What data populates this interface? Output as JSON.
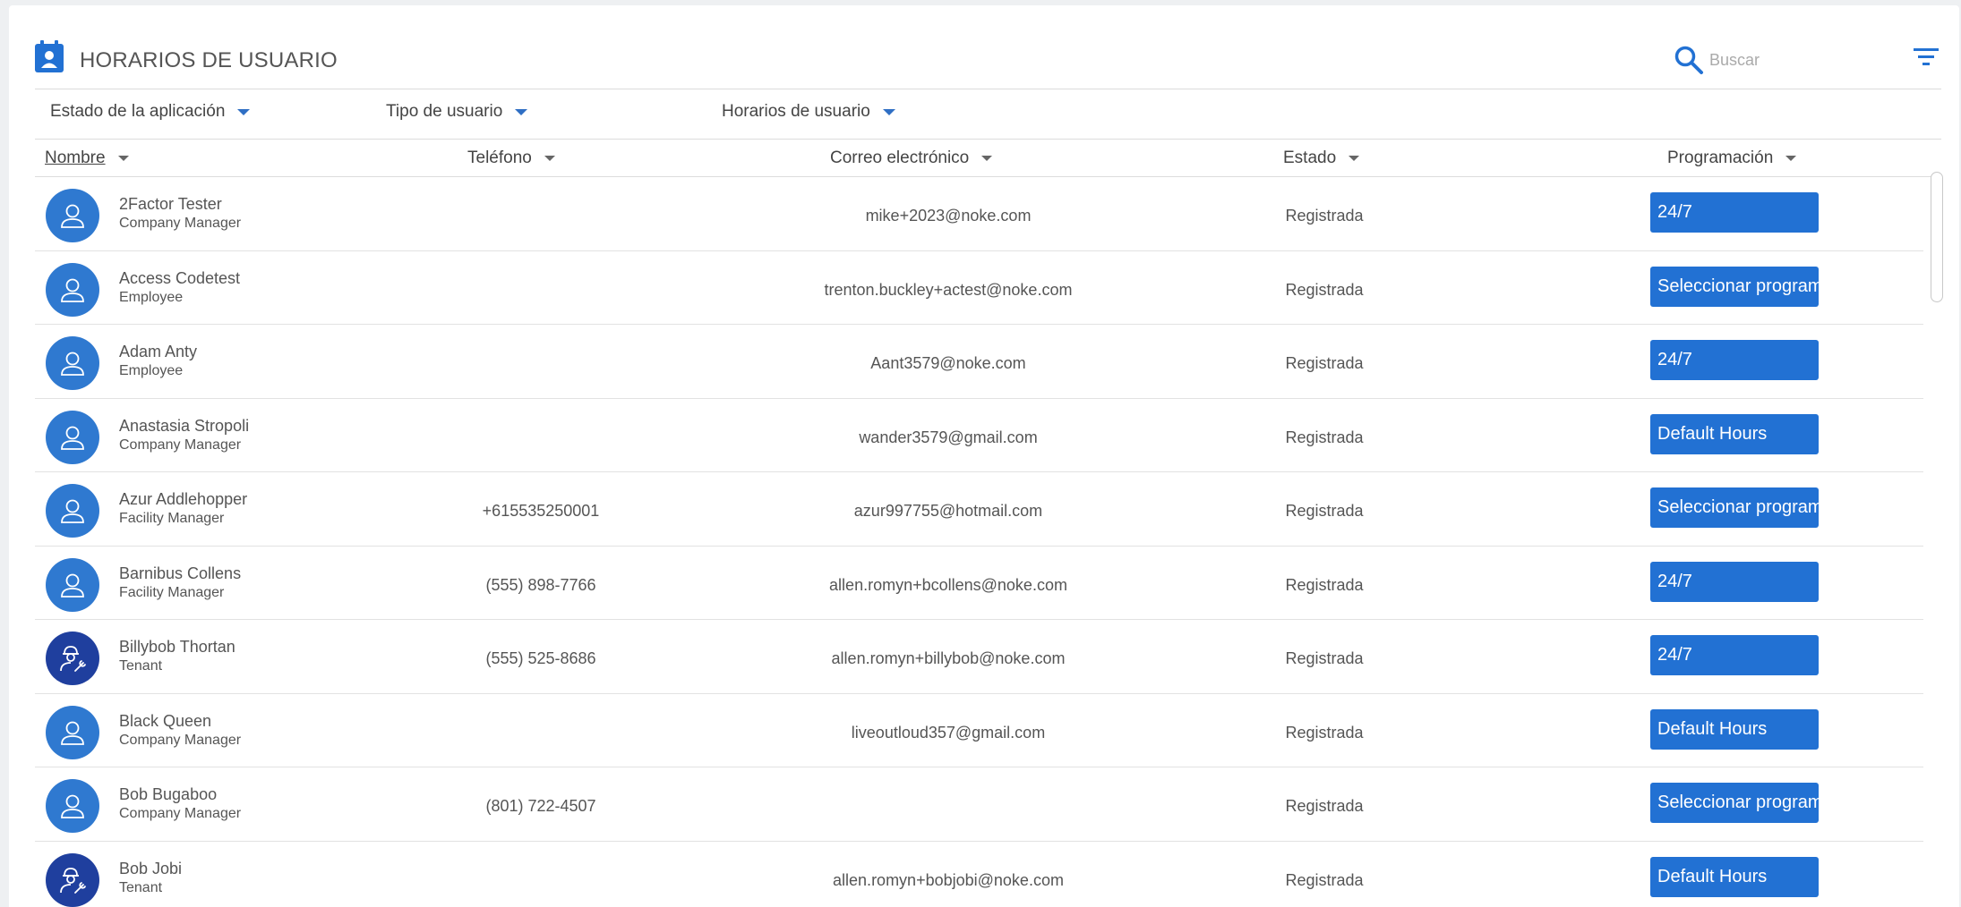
{
  "header": {
    "title": "HORARIOS DE USUARIO",
    "search_placeholder": "Buscar",
    "accent": "#2271d3"
  },
  "filters": [
    {
      "label": "Estado de la aplicación"
    },
    {
      "label": "Tipo de usuario"
    },
    {
      "label": "Horarios de usuario"
    }
  ],
  "columns": {
    "name": "Nombre",
    "phone": "Teléfono",
    "email": "Correo electrónico",
    "status": "Estado",
    "schedule": "Programación"
  },
  "rows": [
    {
      "name": "2Factor Tester",
      "role": "Company Manager",
      "phone": "",
      "email": "mike+2023@noke.com",
      "status": "Registrada",
      "schedule": "24/7",
      "avatar": "person-icon"
    },
    {
      "name": "Access Codetest",
      "role": "Employee",
      "phone": "",
      "email": "trenton.buckley+actest@noke.com",
      "status": "Registrada",
      "schedule": "Seleccionar programa",
      "avatar": "person-icon"
    },
    {
      "name": "Adam Anty",
      "role": "Employee",
      "phone": "",
      "email": "Aant3579@noke.com",
      "status": "Registrada",
      "schedule": "24/7",
      "avatar": "person-icon"
    },
    {
      "name": "Anastasia Stropoli",
      "role": "Company Manager",
      "phone": "",
      "email": "wander3579@gmail.com",
      "status": "Registrada",
      "schedule": "Default Hours",
      "avatar": "person-icon"
    },
    {
      "name": "Azur Addlehopper",
      "role": "Facility Manager",
      "phone": "+615535250001",
      "email": "azur997755@hotmail.com",
      "status": "Registrada",
      "schedule": "Seleccionar programa",
      "avatar": "person-icon"
    },
    {
      "name": "Barnibus Collens",
      "role": "Facility Manager",
      "phone": "(555) 898-7766",
      "email": "allen.romyn+bcollens@noke.com",
      "status": "Registrada",
      "schedule": "24/7",
      "avatar": "person-icon"
    },
    {
      "name": "Billybob Thortan",
      "role": "Tenant",
      "phone": "(555) 525-8686",
      "email": "allen.romyn+billybob@noke.com",
      "status": "Registrada",
      "schedule": "24/7",
      "avatar": "worker-icon"
    },
    {
      "name": "Black Queen",
      "role": "Company Manager",
      "phone": "",
      "email": "liveoutloud357@gmail.com",
      "status": "Registrada",
      "schedule": "Default Hours",
      "avatar": "person-icon"
    },
    {
      "name": "Bob Bugaboo",
      "role": "Company Manager",
      "phone": "(801) 722-4507",
      "email": "",
      "status": "Registrada",
      "schedule": "Seleccionar programa",
      "avatar": "person-icon"
    },
    {
      "name": "Bob Jobi",
      "role": "Tenant",
      "phone": "",
      "email": "allen.romyn+bobjobi@noke.com",
      "status": "Registrada",
      "schedule": "Default Hours",
      "avatar": "worker-icon"
    }
  ]
}
